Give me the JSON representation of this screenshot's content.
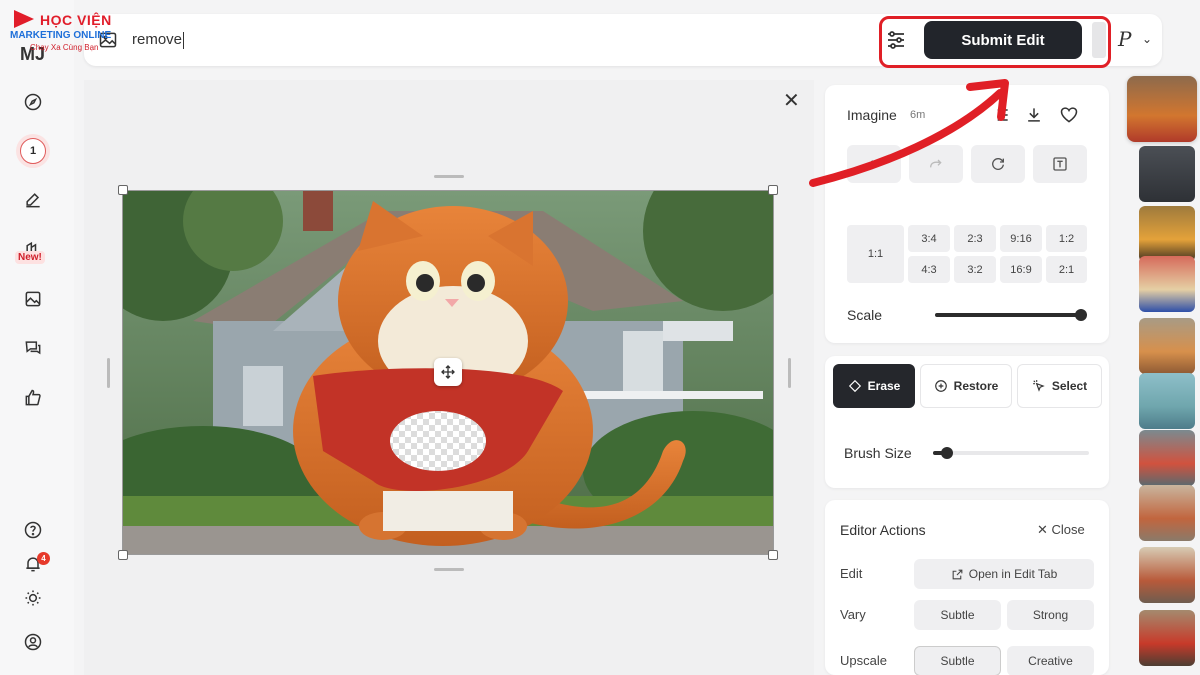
{
  "logo": {
    "line1": "HỌC VIỆN",
    "line2": "MARKETING ONLINE",
    "line3": "Chạy Xa Cùng Bạn"
  },
  "app": {
    "mark": "MJ"
  },
  "sidebar": {
    "items": [
      {
        "icon": "compass-icon"
      },
      {
        "icon": "count-icon",
        "count": "1"
      },
      {
        "icon": "edit-icon"
      },
      {
        "icon": "new-feature-icon",
        "badge": "New!"
      },
      {
        "icon": "image-icon"
      },
      {
        "icon": "chat-icon"
      },
      {
        "icon": "thumbs-up-icon"
      }
    ],
    "bottom": [
      {
        "icon": "help-icon"
      },
      {
        "icon": "bell-icon",
        "badge": "4"
      },
      {
        "icon": "sun-icon"
      },
      {
        "icon": "profile-icon"
      }
    ]
  },
  "topbar": {
    "prompt_value": "remove",
    "submit_label": "Submit Edit",
    "profile_letter": "P"
  },
  "panel": {
    "imagine_label": "Imagine",
    "imagine_time": "6m",
    "ratios": {
      "main": "1:1",
      "row1": [
        "3:4",
        "2:3",
        "9:16",
        "1:2"
      ],
      "row2": [
        "4:3",
        "3:2",
        "16:9",
        "2:1"
      ]
    },
    "scale_label": "Scale",
    "scale_value": 1.0,
    "modes": {
      "erase": "Erase",
      "restore": "Restore",
      "select": "Select"
    },
    "brush_label": "Brush Size",
    "brush_value": 0.08,
    "editor_actions": {
      "title": "Editor Actions",
      "close": "Close",
      "edit_label": "Edit",
      "open_edit_tab": "Open in Edit Tab",
      "vary_label": "Vary",
      "vary_subtle": "Subtle",
      "vary_strong": "Strong",
      "upscale_label": "Upscale",
      "upscale_subtle": "Subtle",
      "upscale_creative": "Creative"
    }
  },
  "colors": {
    "accent": "#22252b",
    "highlight": "#e01f26"
  }
}
